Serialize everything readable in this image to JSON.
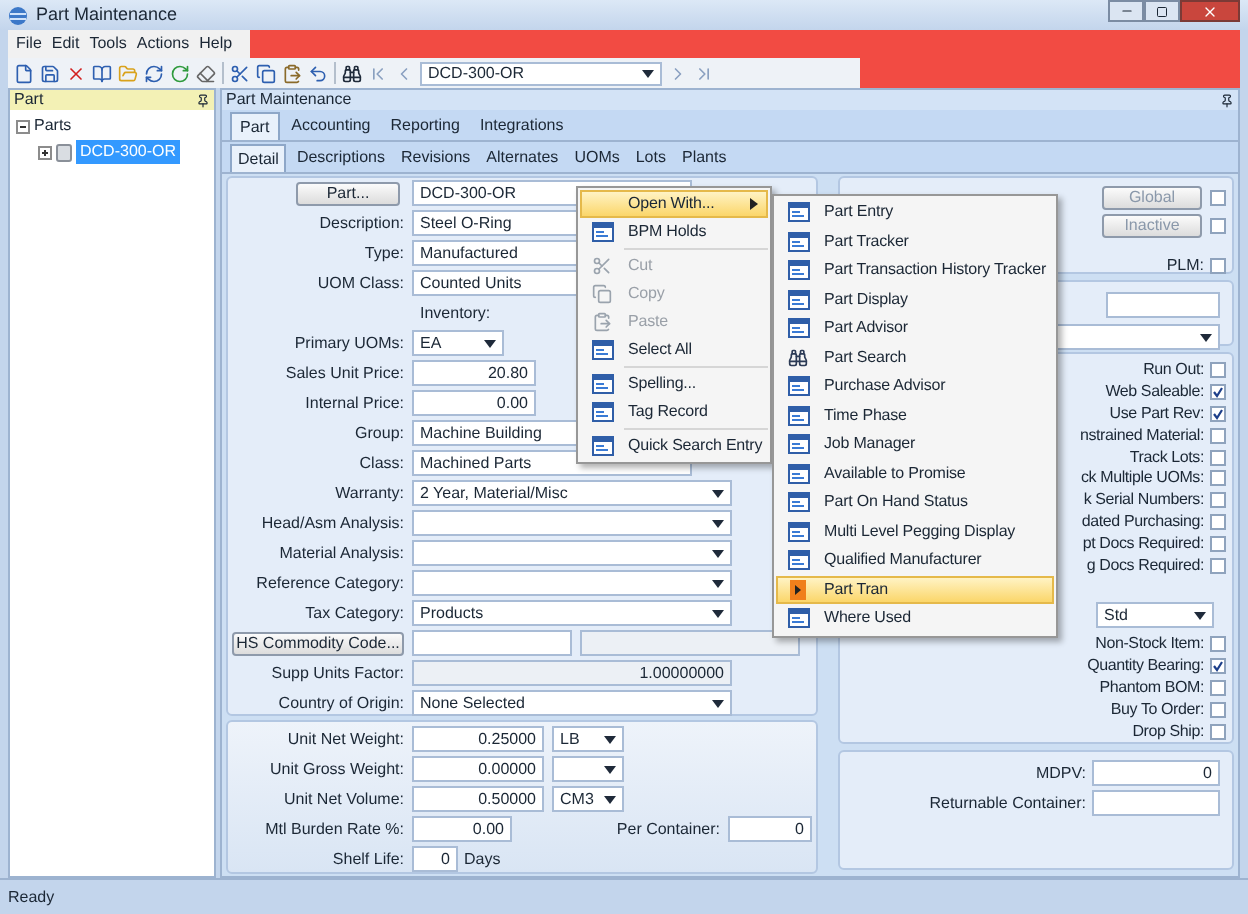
{
  "window": {
    "title": "Part Maintenance"
  },
  "menu_bar": [
    "File",
    "Edit",
    "Tools",
    "Actions",
    "Help"
  ],
  "toolbar": {
    "record_value": "DCD-300-OR"
  },
  "tree_pane": {
    "title": "Part",
    "root": {
      "label": "Parts",
      "expanded": true,
      "children": [
        {
          "label": "DCD-300-OR",
          "selected": true,
          "expanded": false
        }
      ]
    }
  },
  "main_pane": {
    "title": "Part Maintenance"
  },
  "tabs": [
    {
      "label": "Part",
      "selected": true
    },
    {
      "label": "Accounting",
      "selected": false
    },
    {
      "label": "Reporting",
      "selected": false
    },
    {
      "label": "Integrations",
      "selected": false
    }
  ],
  "subtabs": [
    {
      "label": "Detail",
      "selected": true
    },
    {
      "label": "Descriptions",
      "selected": false
    },
    {
      "label": "Revisions",
      "selected": false
    },
    {
      "label": "Alternates",
      "selected": false
    },
    {
      "label": "UOMs",
      "selected": false
    },
    {
      "label": "Lots",
      "selected": false
    },
    {
      "label": "Plants",
      "selected": false
    }
  ],
  "form": [
    {
      "kind": "lookup",
      "button": "Part...",
      "value": "DCD-300-OR"
    },
    {
      "kind": "text",
      "label": "Description:",
      "value": "Steel O-Ring"
    },
    {
      "kind": "text",
      "label": "Type:",
      "value": "Manufactured"
    },
    {
      "kind": "text",
      "label": "UOM Class:",
      "value": "Counted Units"
    },
    {
      "kind": "caption",
      "value": "Inventory:"
    },
    {
      "kind": "short_dropdown",
      "label": "Primary UOMs:",
      "value": "EA"
    },
    {
      "kind": "number",
      "label": "Sales Unit Price:",
      "value": "20.80"
    },
    {
      "kind": "number",
      "label": "Internal Price:",
      "value": "0.00"
    },
    {
      "kind": "text",
      "label": "Group:",
      "value": "Machine Building"
    },
    {
      "kind": "text",
      "label": "Class:",
      "value": "Machined Parts"
    },
    {
      "kind": "dropdown",
      "label": "Warranty:",
      "value": "2 Year, Material/Misc"
    },
    {
      "kind": "dropdown",
      "label": "Head/Asm Analysis:"
    },
    {
      "kind": "dropdown",
      "label": "Material Analysis:"
    },
    {
      "kind": "dropdown",
      "label": "Reference Category:"
    },
    {
      "kind": "dropdown",
      "label": "Tax Category:",
      "value": "Products"
    },
    {
      "kind": "code",
      "button": "HS Commodity Code..."
    },
    {
      "kind": "readonly",
      "label": "Supp Units Factor:",
      "value": "1.00000000"
    },
    {
      "kind": "dropdown",
      "label": "Country of Origin:",
      "value": "None Selected"
    }
  ],
  "measures": [
    {
      "kind": "measure",
      "label": "Unit Net Weight:",
      "value": "0.25000",
      "unit": "LB"
    },
    {
      "kind": "measure",
      "label": "Unit Gross Weight:",
      "value": "0.00000"
    },
    {
      "kind": "measure",
      "label": "Unit Net Volume:",
      "value": "0.50000",
      "unit": "CM3"
    },
    {
      "kind": "rate",
      "label": "Mtl Burden Rate %:",
      "value": "0.00",
      "extra_label": "Per Container:",
      "extra_value": "0"
    },
    {
      "kind": "days",
      "label": "Shelf Life:",
      "value": "0",
      "suffix": "Days"
    }
  ],
  "status_buttons": [
    {
      "label": "Global",
      "disabled": true,
      "checked": false
    },
    {
      "label": "Inactive",
      "disabled": true,
      "checked": false
    }
  ],
  "plm": {
    "label": "PLM:",
    "checked": false
  },
  "flags": [
    {
      "label": "Run Out:",
      "checked": false
    },
    {
      "label": "Web Saleable:",
      "checked": true
    },
    {
      "label": "Use Part Rev:",
      "checked": true
    },
    {
      "label": "nstrained Material:",
      "checked": false
    },
    {
      "label": "Track Lots:",
      "checked": false
    },
    {
      "label": "ck Multiple UOMs:",
      "checked": false
    },
    {
      "label": "k Serial Numbers:",
      "checked": false
    },
    {
      "label": "dated Purchasing:",
      "checked": false
    },
    {
      "label": "pt Docs Required:",
      "checked": false
    },
    {
      "label": "g Docs Required:",
      "checked": false
    }
  ],
  "costing_method": "Std",
  "flags_2": [
    {
      "label": "Non-Stock Item:",
      "checked": false
    },
    {
      "label": "Quantity Bearing:",
      "checked": true
    },
    {
      "label": "Phantom BOM:",
      "checked": false
    },
    {
      "label": "Buy To Order:",
      "checked": false
    },
    {
      "label": "Drop Ship:",
      "checked": false
    }
  ],
  "container": [
    {
      "label": "MDPV:",
      "value": "0"
    },
    {
      "label": "Returnable Container:"
    }
  ],
  "context_menu": [
    {
      "kind": "submenu",
      "label": "Open With...",
      "selected": true,
      "disabled": false
    },
    {
      "kind": "form",
      "label": "BPM Holds",
      "selected": false,
      "disabled": false
    },
    {
      "kind": "separator"
    },
    {
      "kind": "cut",
      "label": "Cut",
      "selected": false,
      "disabled": true
    },
    {
      "kind": "copy",
      "label": "Copy",
      "selected": false,
      "disabled": true
    },
    {
      "kind": "paste",
      "label": "Paste",
      "selected": false,
      "disabled": true
    },
    {
      "kind": "form",
      "label": "Select All",
      "selected": false,
      "disabled": false
    },
    {
      "kind": "separator"
    },
    {
      "kind": "form",
      "label": "Spelling...",
      "selected": false,
      "disabled": false
    },
    {
      "kind": "form",
      "label": "Tag Record",
      "selected": false,
      "disabled": false
    },
    {
      "kind": "separator"
    },
    {
      "kind": "form",
      "label": "Quick Search Entry",
      "selected": false,
      "disabled": false
    }
  ],
  "submenu": [
    {
      "kind": "form",
      "label": "Part Entry",
      "selected": false
    },
    {
      "kind": "form",
      "label": "Part Tracker",
      "selected": false
    },
    {
      "kind": "form",
      "label": "Part Transaction History Tracker",
      "selected": false
    },
    {
      "kind": "form",
      "label": "Part Display",
      "selected": false
    },
    {
      "kind": "form",
      "label": "Part Advisor",
      "selected": false
    },
    {
      "kind": "search",
      "label": "Part Search",
      "selected": false
    },
    {
      "kind": "form",
      "label": "Purchase Advisor",
      "selected": false
    },
    {
      "kind": "form",
      "label": "Time Phase",
      "selected": false
    },
    {
      "kind": "form",
      "label": "Job Manager",
      "selected": false
    },
    {
      "kind": "form",
      "label": "Available to Promise",
      "selected": false
    },
    {
      "kind": "form",
      "label": "Part On Hand Status",
      "selected": false
    },
    {
      "kind": "form",
      "label": "Multi Level Pegging Display",
      "selected": false
    },
    {
      "kind": "form",
      "label": "Qualified Manufacturer",
      "selected": false
    },
    {
      "kind": "arrow",
      "label": "Part Tran",
      "selected": true
    },
    {
      "kind": "form",
      "label": "Where Used",
      "selected": false
    }
  ],
  "status_bar": "Ready"
}
